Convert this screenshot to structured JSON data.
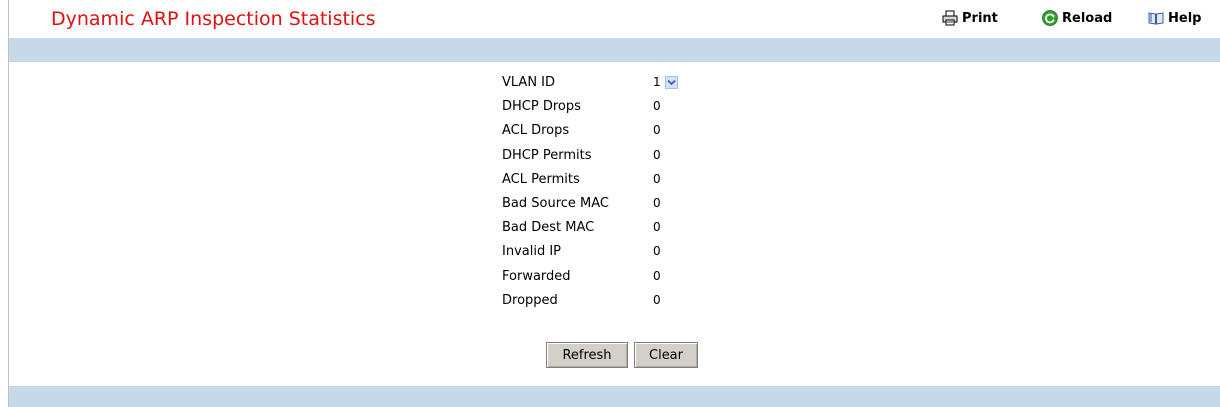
{
  "page": {
    "title": "Dynamic ARP Inspection Statistics"
  },
  "toolbar": {
    "print_label": "Print",
    "reload_label": "Reload",
    "help_label": "Help"
  },
  "vlan": {
    "label": "VLAN ID",
    "selected": "1"
  },
  "stats": [
    {
      "label": "DHCP Drops",
      "value": "0"
    },
    {
      "label": "ACL Drops",
      "value": "0"
    },
    {
      "label": "DHCP Permits",
      "value": "0"
    },
    {
      "label": "ACL Permits",
      "value": "0"
    },
    {
      "label": "Bad Source MAC",
      "value": "0"
    },
    {
      "label": "Bad Dest MAC",
      "value": "0"
    },
    {
      "label": "Invalid IP",
      "value": "0"
    },
    {
      "label": "Forwarded",
      "value": "0"
    },
    {
      "label": "Dropped",
      "value": "0"
    }
  ],
  "buttons": {
    "refresh_label": "Refresh",
    "clear_label": "Clear"
  },
  "colors": {
    "title": "#e01010",
    "band": "#c6d9ea"
  }
}
